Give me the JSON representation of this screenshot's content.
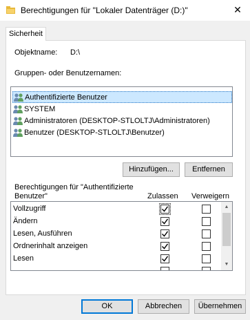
{
  "window": {
    "title": "Berechtigungen für \"Lokaler Datenträger (D:)\"",
    "close_glyph": "✕"
  },
  "tab": {
    "label": "Sicherheit"
  },
  "object": {
    "label": "Objektname:",
    "value": "D:\\"
  },
  "groups": {
    "label": "Gruppen- oder Benutzernamen:",
    "items": [
      {
        "label": "Authentifizierte Benutzer",
        "icon": "users-group-icon",
        "selected": true
      },
      {
        "label": "SYSTEM",
        "icon": "users-group-icon",
        "selected": false
      },
      {
        "label": "Administratoren (DESKTOP-STLOLTJ\\Administratoren)",
        "icon": "users-group-icon",
        "selected": false
      },
      {
        "label": "Benutzer (DESKTOP-STLOLTJ\\Benutzer)",
        "icon": "users-group-icon",
        "selected": false
      }
    ]
  },
  "buttons": {
    "add": "Hinzufügen...",
    "remove": "Entfernen",
    "ok": "OK",
    "cancel": "Abbrechen",
    "apply": "Übernehmen"
  },
  "permissions": {
    "label": "Berechtigungen für \"Authentifizierte Benutzer\"",
    "allow_header": "Zulassen",
    "deny_header": "Verweigern",
    "rows": [
      {
        "name": "Vollzugriff",
        "allow": true,
        "deny": false
      },
      {
        "name": "Ändern",
        "allow": true,
        "deny": false
      },
      {
        "name": "Lesen, Ausführen",
        "allow": true,
        "deny": false
      },
      {
        "name": "Ordnerinhalt anzeigen",
        "allow": true,
        "deny": false
      },
      {
        "name": "Lesen",
        "allow": true,
        "deny": false
      },
      {
        "name": "",
        "allow": false,
        "deny": false
      }
    ]
  }
}
